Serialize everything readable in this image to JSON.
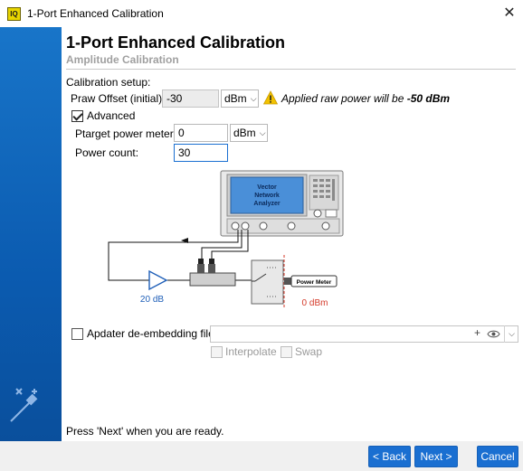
{
  "window": {
    "app_icon_text": "IQ",
    "title": "1-Port Enhanced Calibration",
    "close_glyph": "✕"
  },
  "header": {
    "title": "1-Port Enhanced Calibration",
    "subtitle": "Amplitude Calibration"
  },
  "setup": {
    "section_label": "Calibration setup:",
    "praw_label": "Praw Offset (initial):",
    "praw_value": "-30",
    "praw_unit": "dBm",
    "warning_prefix": "Applied raw power will be ",
    "warning_value": "-50 dBm",
    "advanced_label": "Advanced",
    "advanced_checked": true,
    "ptarget_label": "Ptarget power meter:",
    "ptarget_value": "0",
    "ptarget_unit": "dBm",
    "power_count_label": "Power count:",
    "power_count_value": "30"
  },
  "diagram": {
    "vna_label_1": "Vector",
    "vna_label_2": "Network",
    "vna_label_3": "Analyzer",
    "amp_gain": "20 dB",
    "power_meter_label": "Power Meter",
    "power_meter_level": "0 dBm"
  },
  "embedding": {
    "label": "Apdater de-embedding file:",
    "checked": false,
    "value": "",
    "interpolate_label": "Interpolate",
    "swap_label": "Swap"
  },
  "footer": {
    "hint": "Press 'Next' when you are ready.",
    "back_label": "< Back",
    "next_label": "Next >",
    "cancel_label": "Cancel"
  },
  "colors": {
    "side_panel": "#0b5bb0",
    "button_blue": "#1a6fd1",
    "warning_yellow": "#f2c200",
    "gain_blue": "#1f5fb8",
    "power_red": "#d43a2a"
  }
}
